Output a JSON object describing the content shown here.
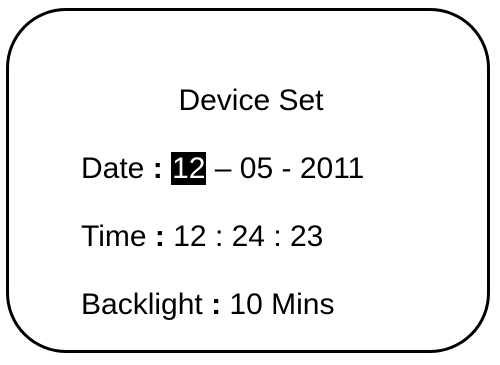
{
  "screen": {
    "title": "Device Set",
    "rows": {
      "date": {
        "label": "Date",
        "separator": ":",
        "day": "12",
        "rest": "– 05 - 2011",
        "selected_field": "day"
      },
      "time": {
        "label": "Time",
        "separator": ":",
        "value": "12 : 24 : 23"
      },
      "backlight": {
        "label": "Backlight",
        "separator": ":",
        "value": "10 Mins"
      }
    }
  }
}
